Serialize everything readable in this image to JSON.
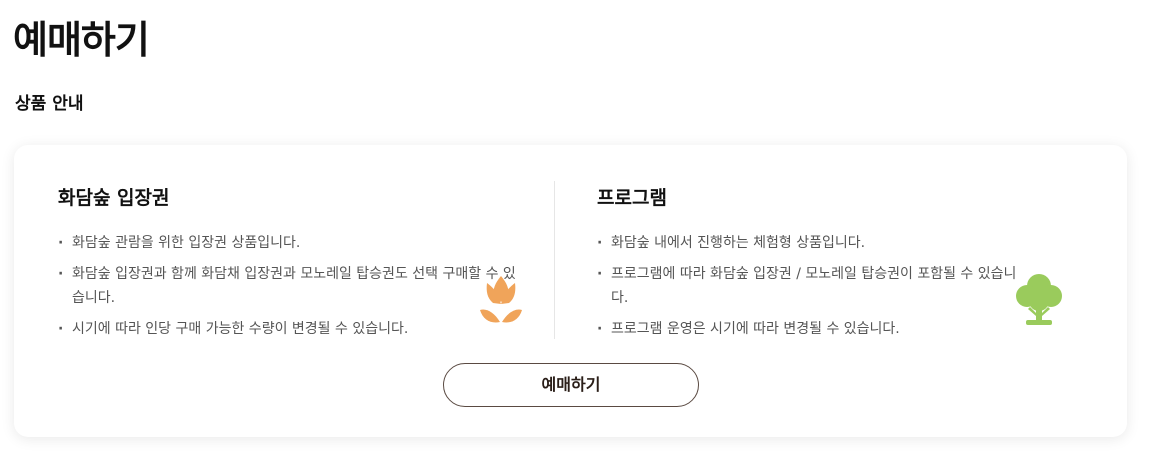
{
  "page": {
    "title": "예매하기",
    "section_title": "상품 안내"
  },
  "products": [
    {
      "name": "화담숲 입장권",
      "icon": "tulip-icon",
      "icon_color": "#F0A45A",
      "items": [
        "화담숲 관람을 위한 입장권 상품입니다.",
        "화담숲 입장권과 함께 화담채 입장권과 모노레일 탑승권도 선택 구매할 수 있습니다.",
        "시기에 따라 인당 구매 가능한 수량이 변경될 수 있습니다."
      ]
    },
    {
      "name": "프로그램",
      "icon": "tree-icon",
      "icon_color": "#9ACB5C",
      "items": [
        "화담숲 내에서 진행하는 체험형 상품입니다.",
        "프로그램에 따라 화담숲 입장권 / 모노레일 탑승권이 포함될 수 있습니다.",
        "프로그램 운영은 시기에 따라 변경될 수 있습니다."
      ]
    }
  ],
  "booking": {
    "button_label": "예매하기",
    "border_color": "#5A4A42"
  }
}
